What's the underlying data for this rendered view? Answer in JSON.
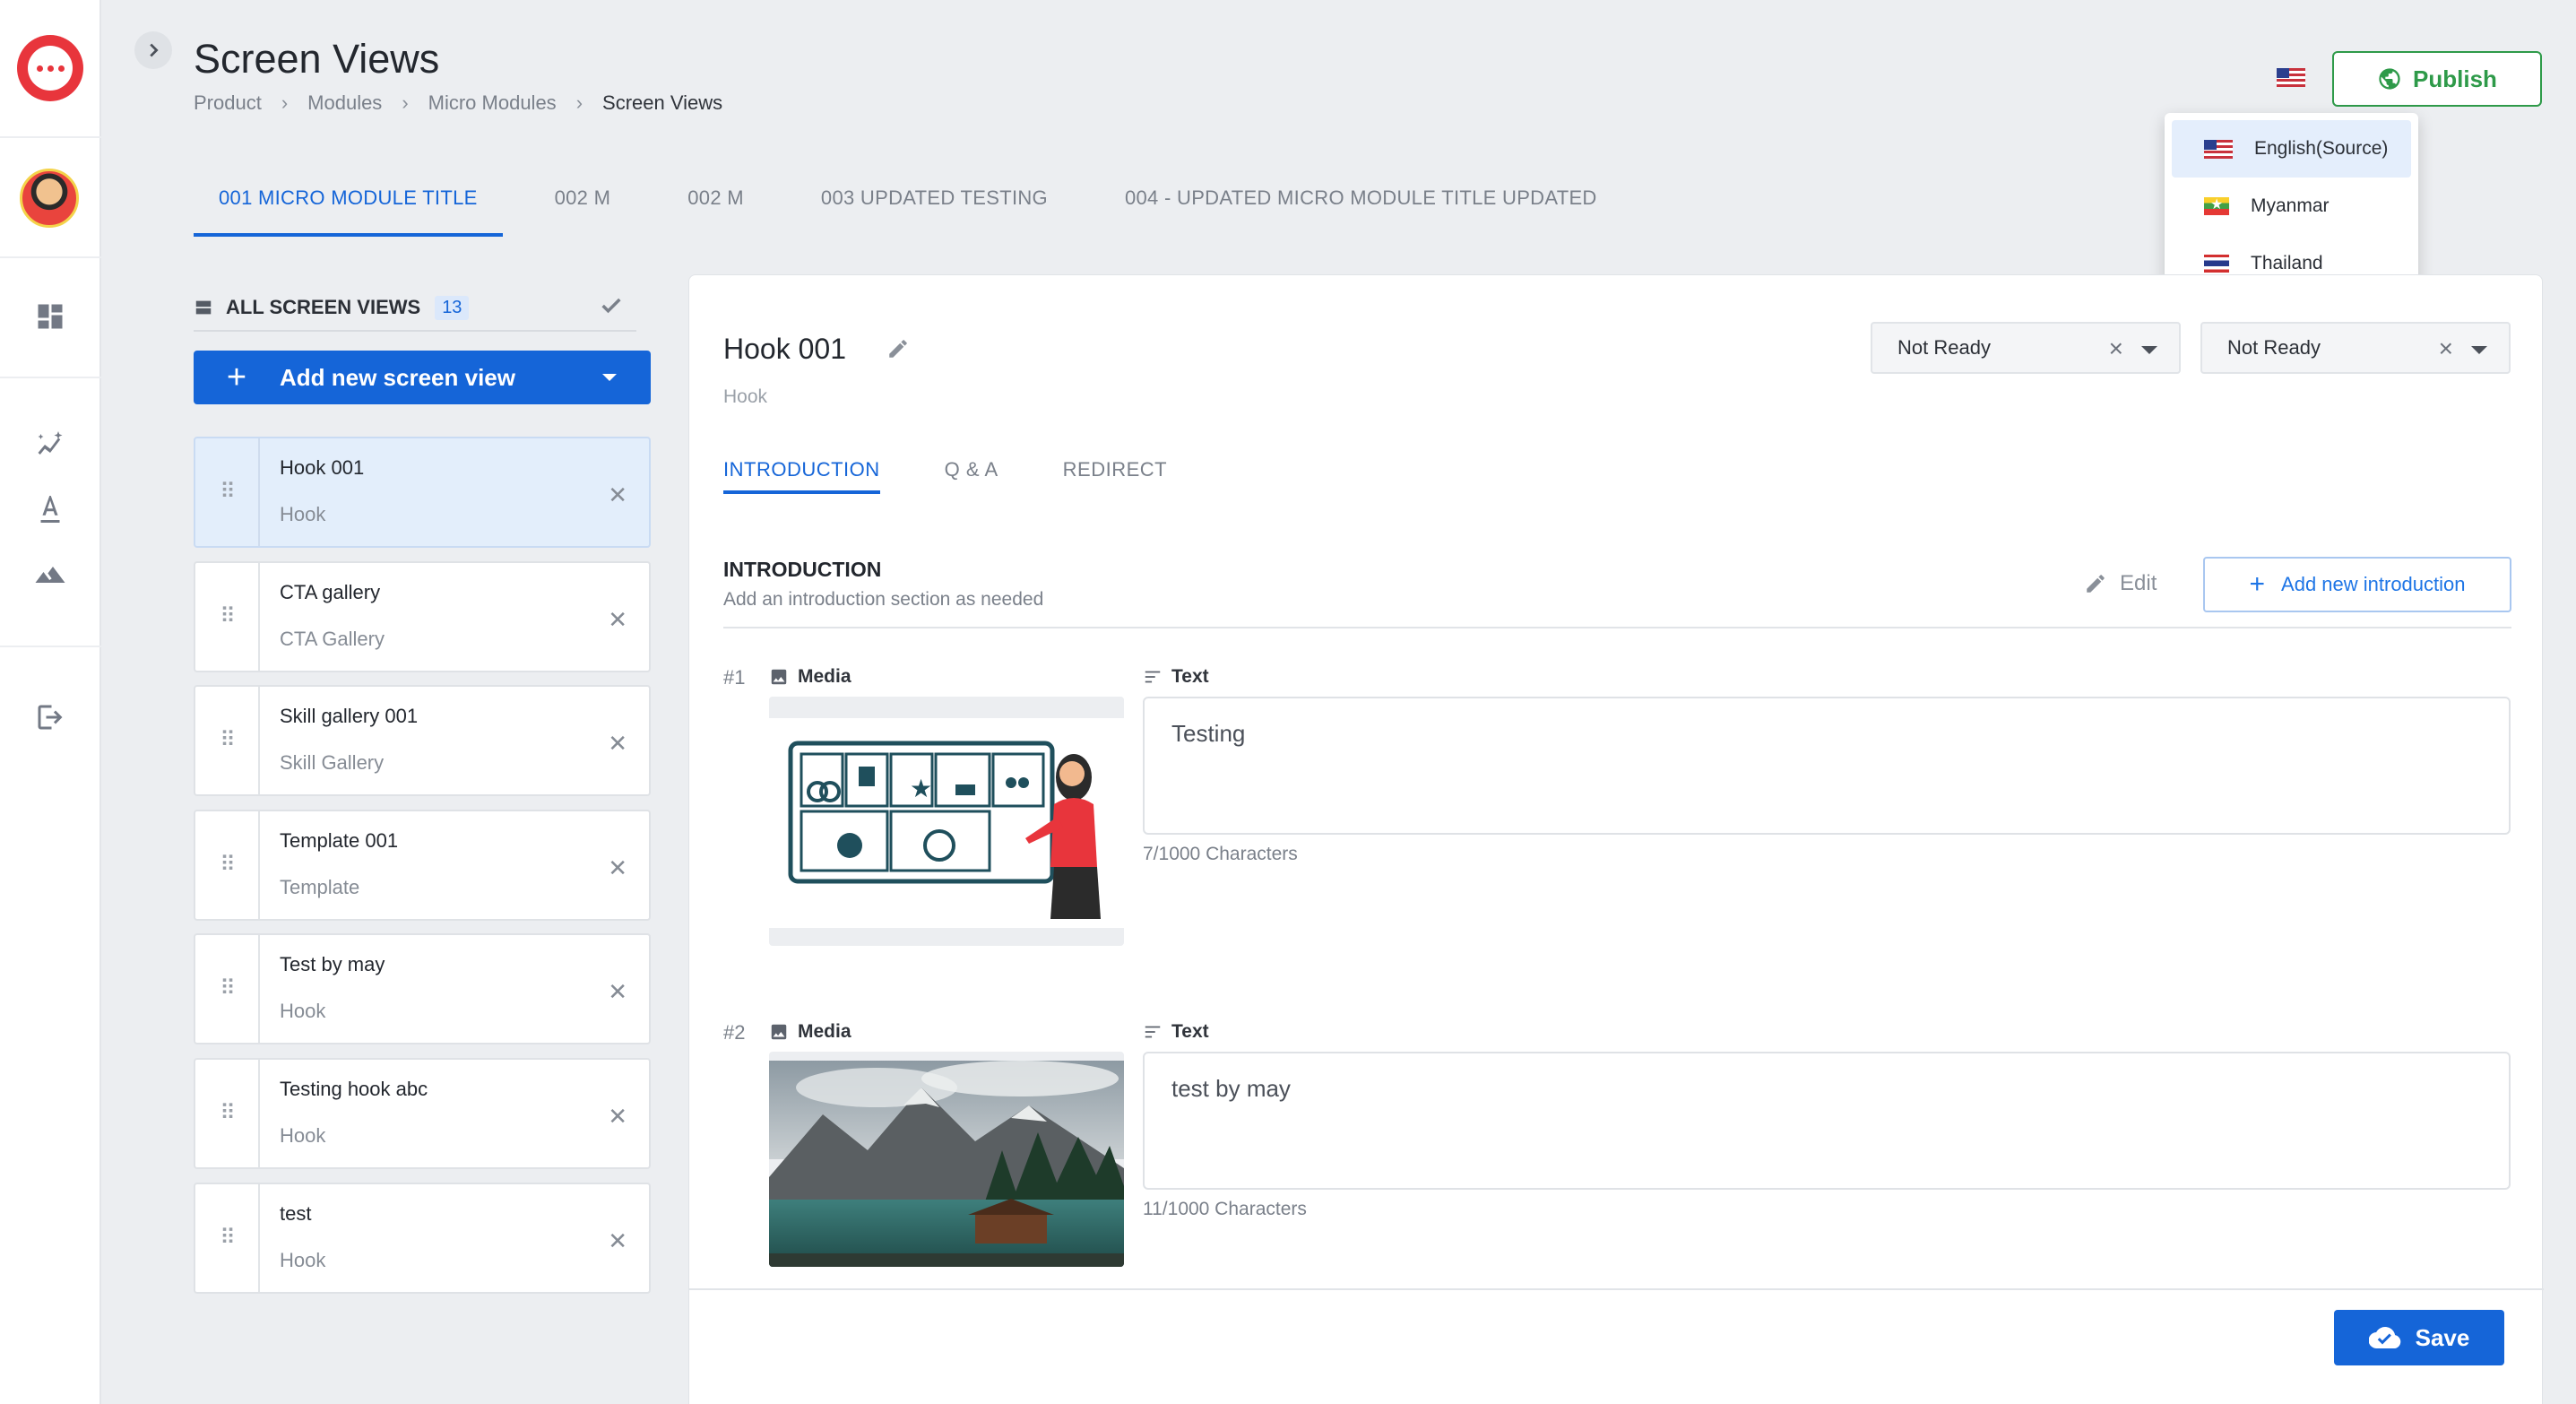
{
  "app": {
    "page_title": "Screen Views",
    "breadcrumb": [
      "Product",
      "Modules",
      "Micro Modules",
      "Screen Views"
    ]
  },
  "rail": {
    "icons": [
      "chat-logo-icon",
      "avatar",
      "dashboard-icon",
      "sparkle-chart-icon",
      "text-format-icon",
      "landscape-icon",
      "logout-icon"
    ]
  },
  "header": {
    "publish_label": "Publish",
    "language_menu": {
      "items": [
        {
          "label": "English(Source)",
          "flag": "us-flag-icon",
          "selected": true
        },
        {
          "label": "Myanmar",
          "flag": "myanmar-flag-icon",
          "selected": false
        },
        {
          "label": "Thailand",
          "flag": "thailand-flag-icon",
          "selected": false
        }
      ]
    }
  },
  "module_tabs": [
    {
      "label": "001 MICRO MODULE TITLE",
      "active": true
    },
    {
      "label": "002 M",
      "active": false
    },
    {
      "label": "002 M",
      "active": false
    },
    {
      "label": "003 UPDATED TESTING",
      "active": false
    },
    {
      "label": "004 - UPDATED MICRO MODULE TITLE UPDATED",
      "active": false
    }
  ],
  "screen_views": {
    "header_label": "ALL SCREEN VIEWS",
    "count": "13",
    "add_button_label": "Add new screen view",
    "items": [
      {
        "name": "Hook 001",
        "type": "Hook",
        "active": true
      },
      {
        "name": "CTA gallery",
        "type": "CTA Gallery",
        "active": false
      },
      {
        "name": "Skill gallery 001",
        "type": "Skill Gallery",
        "active": false
      },
      {
        "name": "Template 001",
        "type": "Template",
        "active": false
      },
      {
        "name": "Test by may",
        "type": "Hook",
        "active": false
      },
      {
        "name": "Testing hook abc",
        "type": "Hook",
        "active": false
      },
      {
        "name": "test",
        "type": "Hook",
        "active": false
      }
    ]
  },
  "detail": {
    "title": "Hook 001",
    "subtitle": "Hook",
    "status_1": "Not Ready",
    "status_2": "Not Ready",
    "tabs": [
      "INTRODUCTION",
      "Q & A",
      "REDIRECT"
    ],
    "active_tab": "INTRODUCTION",
    "section_title": "INTRODUCTION",
    "section_desc": "Add an introduction section as needed",
    "edit_label": "Edit",
    "add_intro_label": "Add new introduction",
    "media_label": "Media",
    "text_label": "Text",
    "entries": [
      {
        "num": "#1",
        "text": "Testing",
        "chars": "7/1000 Characters",
        "media": "business-illustration"
      },
      {
        "num": "#2",
        "text": "test by may",
        "chars": "11/1000 Characters",
        "media": "mountain-lake-photo"
      }
    ],
    "save_label": "Save"
  },
  "colors": {
    "primary": "#1565d8",
    "publish_green": "#2e9a49",
    "brand_red": "#e8353c",
    "active_card_bg": "#e3eefb"
  }
}
